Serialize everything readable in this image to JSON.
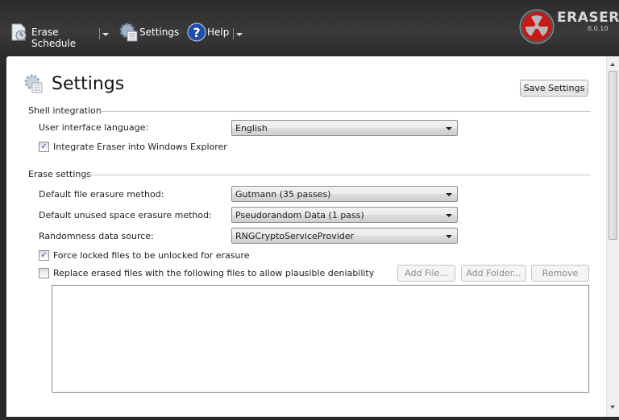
{
  "toolbar": {
    "erase_schedule": "Erase Schedule",
    "settings": "Settings",
    "help": "Help"
  },
  "logo": {
    "name": "ERASER",
    "version": "6.0.10"
  },
  "page": {
    "title": "Settings",
    "save_button": "Save Settings"
  },
  "shell": {
    "header": "Shell integration",
    "language_label": "User interface language:",
    "language_value": "English",
    "integrate_label": "Integrate Eraser into Windows Explorer",
    "integrate_checked": true
  },
  "erase": {
    "header": "Erase settings",
    "file_method_label": "Default file erasure method:",
    "file_method_value": "Gutmann (35 passes)",
    "unused_method_label": "Default unused space erasure method:",
    "unused_method_value": "Pseudorandom Data (1 pass)",
    "random_label": "Randomness data source:",
    "random_value": "RNGCryptoServiceProvider",
    "force_label": "Force locked files to be unlocked for erasure",
    "force_checked": true,
    "replace_label": "Replace erased files with the following files to allow plausible deniability",
    "replace_checked": false,
    "add_file": "Add File...",
    "add_folder": "Add Folder...",
    "remove": "Remove"
  },
  "colors": {
    "logo_red": "#c81818",
    "help_blue": "#1f4fa8"
  }
}
